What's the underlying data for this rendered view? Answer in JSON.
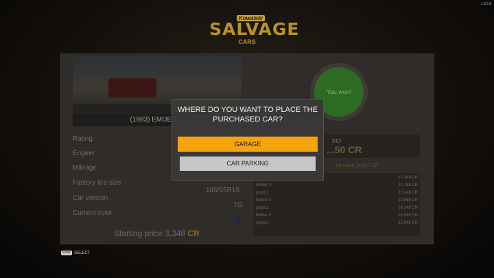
{
  "version": "1.0.5.8",
  "logo": {
    "top": "Kowalski",
    "main": "SALVAGE",
    "sub": "CARS"
  },
  "car": {
    "caption": "(1983) EMDEN ..."
  },
  "specs": [
    {
      "label": "Rating",
      "value": ""
    },
    {
      "label": "Engine",
      "value": ""
    },
    {
      "label": "Mileage",
      "value": ""
    },
    {
      "label": "Factory tire size",
      "value": "185/55R15"
    },
    {
      "label": "Car version",
      "value": "TG"
    },
    {
      "label": "Current color",
      "value": ""
    }
  ],
  "starting_price": {
    "label": "Starting price 3,348",
    "currency": "CR"
  },
  "result": {
    "text": "You won!"
  },
  "bid": {
    "label": "BID",
    "value": "...50",
    "currency": "CR"
  },
  "estimate": "...ed value 16,657 CR",
  "bidders": [
    {
      "name": "",
      "value": "12,348 CR"
    },
    {
      "name": "Bidder 3",
      "value": "12,788 CR"
    },
    {
      "name": "golpl11",
      "value": "13,248 CR"
    },
    {
      "name": "Bidder 2",
      "value": "13,698 CR"
    },
    {
      "name": "golpl11",
      "value": "14,148 CR"
    },
    {
      "name": "Bidder 3",
      "value": "14,598 CR"
    },
    {
      "name": "golpl11",
      "value": "15,048 CR"
    }
  ],
  "modal": {
    "title_line1": "WHERE DO YOU WANT TO PLACE THE",
    "title_line2": "PURCHASED CAR?",
    "garage": "GARAGE",
    "parking": "CAR PARKING"
  },
  "footer": {
    "key": "Enter",
    "label": "SELECT"
  },
  "colors": {
    "accent": "#f4a30d",
    "secondary_button": "#c8c6c4",
    "win": "#2e6b22"
  }
}
